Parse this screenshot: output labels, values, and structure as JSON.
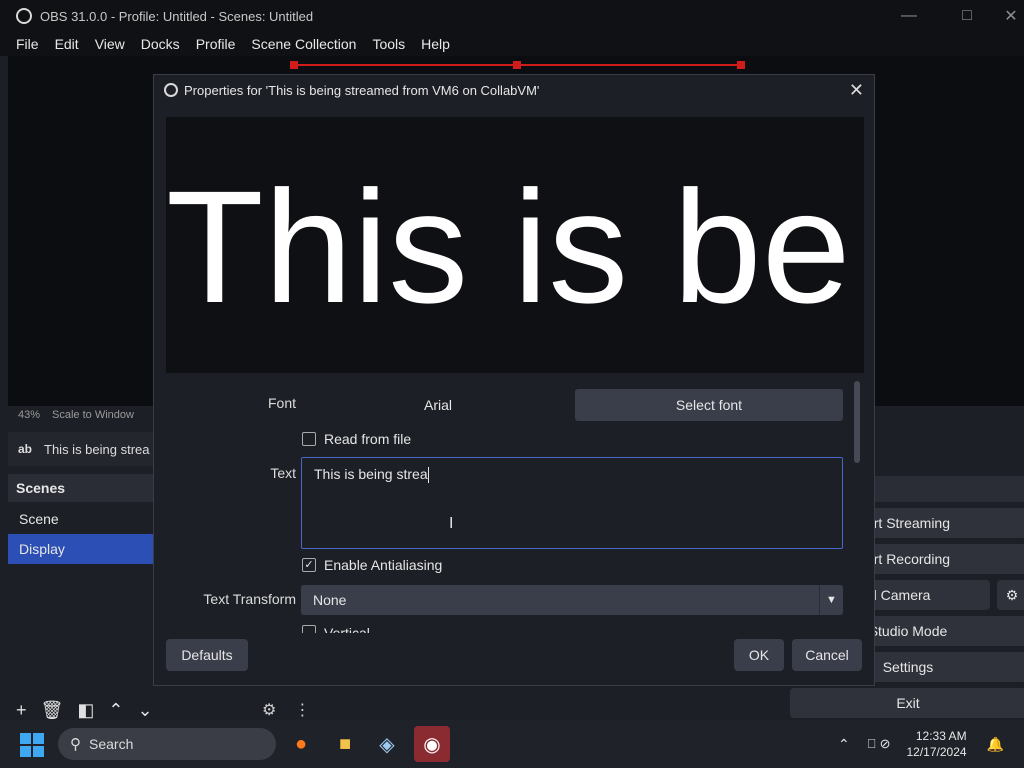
{
  "window": {
    "title": "OBS 31.0.0 - Profile: Untitled - Scenes: Untitled"
  },
  "menu": [
    "File",
    "Edit",
    "View",
    "Docks",
    "Profile",
    "Scene Collection",
    "Tools",
    "Help"
  ],
  "preview_strip": {
    "zoom": "43%",
    "mode": "Scale to Window"
  },
  "source_bar": {
    "icon_text": "ab",
    "label": "This is being strea"
  },
  "scenes": {
    "header": "Scenes",
    "items": [
      "Scene",
      "Display"
    ],
    "active": "Display"
  },
  "controls": [
    "art Streaming",
    "art Recording",
    "rtual Camera",
    "Studio Mode",
    "Settings",
    "Exit"
  ],
  "dialog": {
    "title": "Properties for 'This is being streamed from VM6 on CollabVM'",
    "preview_text": "This is be",
    "font_label": "Font",
    "font_value": "Arial",
    "select_font": "Select font",
    "read_from_file": "Read from file",
    "text_label": "Text",
    "text_value": "This is being strea",
    "enable_antialiasing": "Enable Antialiasing",
    "text_transform_label": "Text Transform",
    "text_transform_value": "None",
    "vertical_label": "Vertical",
    "defaults": "Defaults",
    "ok": "OK",
    "cancel": "Cancel"
  },
  "taskbar": {
    "search_placeholder": "Search",
    "time": "12:33 AM",
    "date": "12/17/2024"
  },
  "colors": {
    "accent": "#2c4fb5",
    "selection": "#d21c1c",
    "focus_border": "#4a66c8"
  }
}
